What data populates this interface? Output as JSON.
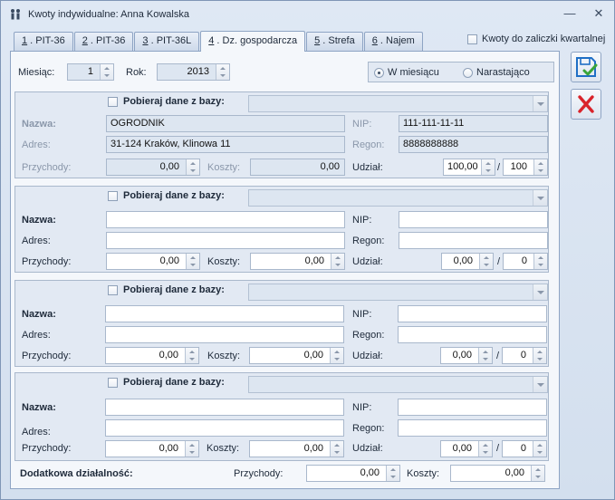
{
  "window": {
    "title": "Kwoty indywidualne: Anna Kowalska",
    "minimize_glyph": "—",
    "close_glyph": "✕"
  },
  "tabs": [
    {
      "num": "1",
      "label": " . PIT-36",
      "active": false
    },
    {
      "num": "2",
      "label": " . PIT-36",
      "active": false
    },
    {
      "num": "3",
      "label": " . PIT-36L",
      "active": false
    },
    {
      "num": "4",
      "label": " . Dz. gospodarcza",
      "active": true
    },
    {
      "num": "5",
      "label": " . Strefa",
      "active": false
    },
    {
      "num": "6",
      "label": " . Najem",
      "active": false
    }
  ],
  "kwartal_label": "Kwoty do zaliczki kwartalnej",
  "period": {
    "month_label": "Miesiąc:",
    "month_value": "1",
    "year_label": "Rok:",
    "year_value": "2013",
    "radio_monthly": "W miesiącu",
    "radio_cumulative": "Narastająco",
    "selected": "monthly"
  },
  "labels": {
    "pobieraj": "Pobieraj dane z bazy:",
    "nazwa": "Nazwa:",
    "nip": "NIP:",
    "adres": "Adres:",
    "regon": "Regon:",
    "przychody": "Przychody:",
    "koszty": "Koszty:",
    "udzial": "Udział:",
    "slash": "/"
  },
  "sections": [
    {
      "nazwa": "OGRODNIK",
      "nip": "111-111-11-11",
      "adres": "31-124 Kraków, Klinowa 11",
      "regon": "8888888888",
      "przychody": "0,00",
      "koszty": "0,00",
      "udzial_a": "100,00",
      "udzial_b": "100"
    },
    {
      "nazwa": "",
      "nip": "",
      "adres": "",
      "regon": "",
      "przychody": "0,00",
      "koszty": "0,00",
      "udzial_a": "0,00",
      "udzial_b": "0"
    },
    {
      "nazwa": "",
      "nip": "",
      "adres": "",
      "regon": "",
      "przychody": "0,00",
      "koszty": "0,00",
      "udzial_a": "0,00",
      "udzial_b": "0"
    },
    {
      "nazwa": "",
      "nip": "",
      "adres": "",
      "regon": "",
      "przychody": "0,00",
      "koszty": "0,00",
      "udzial_a": "0,00",
      "udzial_b": "0"
    }
  ],
  "extra": {
    "label": "Dodatkowa działalność:",
    "przychody_label": "Przychody:",
    "przychody": "0,00",
    "koszty_label": "Koszty:",
    "koszty": "0,00"
  },
  "colors": {
    "accent": "#1f6fc5",
    "save_green": "#3aa53a",
    "cancel_red": "#d9232a"
  },
  "icons": {
    "title": "people-icon",
    "save": "save-disk-icon",
    "cancel": "cancel-x-icon"
  }
}
